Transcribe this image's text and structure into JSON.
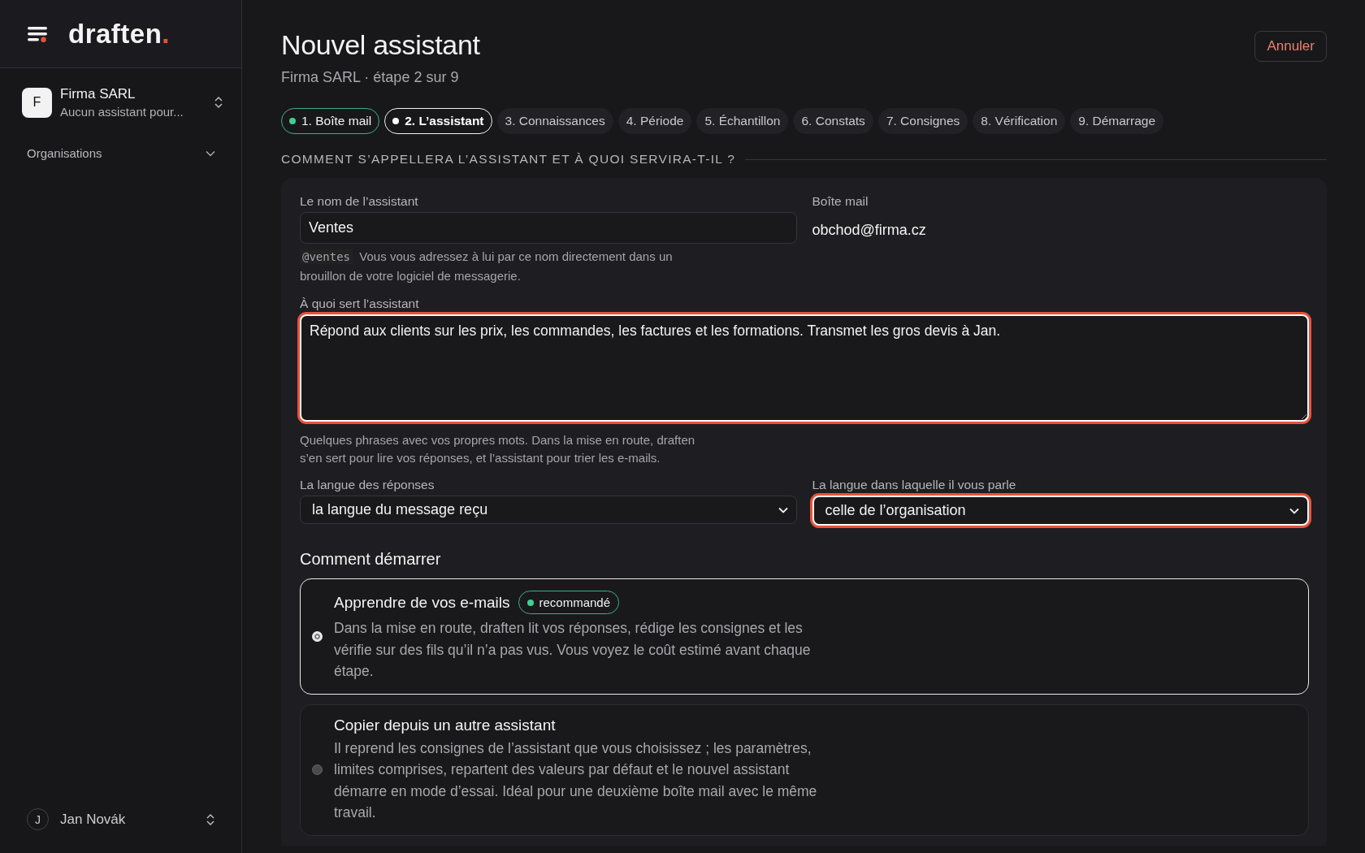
{
  "brand": {
    "name": "draften",
    "dot": "."
  },
  "org": {
    "initial": "F",
    "name": "Firma SARL",
    "subtitle": "Aucun assistant pour..."
  },
  "sidebar": {
    "section": "Organisations",
    "expanded": false
  },
  "user": {
    "initial": "J",
    "name": "Jan Novák"
  },
  "header": {
    "title": "Nouvel assistant",
    "subtitle": "Firma SARL · étape 2 sur 9",
    "cancel": "Annuler"
  },
  "steps": [
    {
      "label": "1. Boîte mail",
      "kind": "done",
      "selected": false
    },
    {
      "label": "2. L’assistant",
      "kind": "current",
      "selected": true
    },
    {
      "label": "3. Connaissances",
      "kind": "todo",
      "selected": false
    },
    {
      "label": "4. Période",
      "kind": "todo",
      "selected": false
    },
    {
      "label": "5. Échantillon",
      "kind": "todo",
      "selected": false
    },
    {
      "label": "6. Constats",
      "kind": "todo",
      "selected": false
    },
    {
      "label": "7. Consignes",
      "kind": "todo",
      "selected": false
    },
    {
      "label": "8. Vérification",
      "kind": "todo",
      "selected": false
    },
    {
      "label": "9. Démarrage",
      "kind": "todo",
      "selected": false
    }
  ],
  "section_heading": "COMMENT S’APPELLERA L’ASSISTANT ET À QUOI SERVIRA-T-IL ?",
  "name_field": {
    "label": "Le nom de l’assistant",
    "value": "Ventes",
    "handle": "@ventes",
    "hint": "Vous vous adressez à lui par ce nom directement dans un brouillon de votre logiciel de messagerie."
  },
  "mailbox": {
    "label": "Boîte mail",
    "value": "obchod@firma.cz"
  },
  "purpose_field": {
    "label": "À quoi sert l’assistant",
    "value": "Répond aux clients sur les prix, les commandes, les factures et les formations. Transmet les gros devis à Jan.",
    "invalid": true,
    "hint": "Quelques phrases avec vos propres mots. Dans la mise en route, draften s’en sert pour lire vos réponses, et l’assistant pour trier les e-mails."
  },
  "selects": [
    {
      "label": "La langue des réponses",
      "value": "la langue du message reçu",
      "invalid": false
    },
    {
      "label": "La langue dans laquelle il vous parle",
      "value": "celle de l’organisation",
      "invalid": true
    }
  ],
  "start_heading": "Comment démarrer",
  "start_options": [
    {
      "title": "Apprendre de vos e-mails",
      "badge": "recommandé",
      "description": "Dans la mise en route, draften lit vos réponses, rédige les consignes et les vérifie sur des fils qu’il n’a pas vus. Vous voyez le coût estimé avant chaque étape.",
      "selected": true
    },
    {
      "title": "Copier depuis un autre assistant",
      "description": "Il reprend les consignes de l’assistant que vous choisissez ; les paramètres, limites comprises, repartent des valeurs par défaut et le nouvel assistant démarre en mode d’essai. Idéal pour une deuxième boîte mail avec le même travail.",
      "selected": false
    }
  ]
}
